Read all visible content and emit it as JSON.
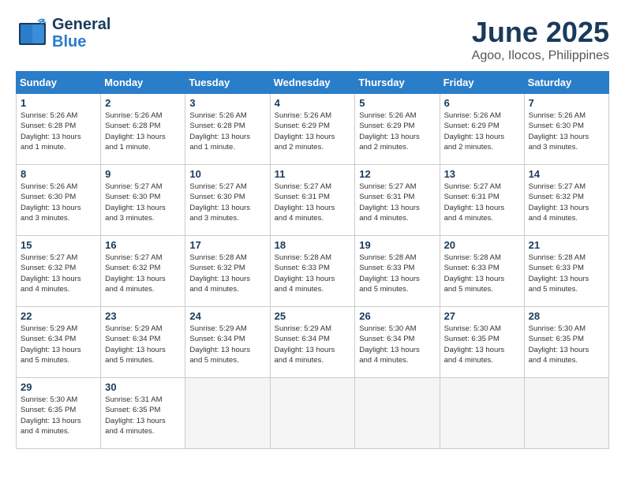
{
  "header": {
    "logo_line1": "General",
    "logo_line2": "Blue",
    "title": "June 2025",
    "subtitle": "Agoo, Ilocos, Philippines"
  },
  "weekdays": [
    "Sunday",
    "Monday",
    "Tuesday",
    "Wednesday",
    "Thursday",
    "Friday",
    "Saturday"
  ],
  "weeks": [
    [
      {
        "day": "1",
        "info": "Sunrise: 5:26 AM\nSunset: 6:28 PM\nDaylight: 13 hours\nand 1 minute."
      },
      {
        "day": "2",
        "info": "Sunrise: 5:26 AM\nSunset: 6:28 PM\nDaylight: 13 hours\nand 1 minute."
      },
      {
        "day": "3",
        "info": "Sunrise: 5:26 AM\nSunset: 6:28 PM\nDaylight: 13 hours\nand 1 minute."
      },
      {
        "day": "4",
        "info": "Sunrise: 5:26 AM\nSunset: 6:29 PM\nDaylight: 13 hours\nand 2 minutes."
      },
      {
        "day": "5",
        "info": "Sunrise: 5:26 AM\nSunset: 6:29 PM\nDaylight: 13 hours\nand 2 minutes."
      },
      {
        "day": "6",
        "info": "Sunrise: 5:26 AM\nSunset: 6:29 PM\nDaylight: 13 hours\nand 2 minutes."
      },
      {
        "day": "7",
        "info": "Sunrise: 5:26 AM\nSunset: 6:30 PM\nDaylight: 13 hours\nand 3 minutes."
      }
    ],
    [
      {
        "day": "8",
        "info": "Sunrise: 5:26 AM\nSunset: 6:30 PM\nDaylight: 13 hours\nand 3 minutes."
      },
      {
        "day": "9",
        "info": "Sunrise: 5:27 AM\nSunset: 6:30 PM\nDaylight: 13 hours\nand 3 minutes."
      },
      {
        "day": "10",
        "info": "Sunrise: 5:27 AM\nSunset: 6:30 PM\nDaylight: 13 hours\nand 3 minutes."
      },
      {
        "day": "11",
        "info": "Sunrise: 5:27 AM\nSunset: 6:31 PM\nDaylight: 13 hours\nand 4 minutes."
      },
      {
        "day": "12",
        "info": "Sunrise: 5:27 AM\nSunset: 6:31 PM\nDaylight: 13 hours\nand 4 minutes."
      },
      {
        "day": "13",
        "info": "Sunrise: 5:27 AM\nSunset: 6:31 PM\nDaylight: 13 hours\nand 4 minutes."
      },
      {
        "day": "14",
        "info": "Sunrise: 5:27 AM\nSunset: 6:32 PM\nDaylight: 13 hours\nand 4 minutes."
      }
    ],
    [
      {
        "day": "15",
        "info": "Sunrise: 5:27 AM\nSunset: 6:32 PM\nDaylight: 13 hours\nand 4 minutes."
      },
      {
        "day": "16",
        "info": "Sunrise: 5:27 AM\nSunset: 6:32 PM\nDaylight: 13 hours\nand 4 minutes."
      },
      {
        "day": "17",
        "info": "Sunrise: 5:28 AM\nSunset: 6:32 PM\nDaylight: 13 hours\nand 4 minutes."
      },
      {
        "day": "18",
        "info": "Sunrise: 5:28 AM\nSunset: 6:33 PM\nDaylight: 13 hours\nand 4 minutes."
      },
      {
        "day": "19",
        "info": "Sunrise: 5:28 AM\nSunset: 6:33 PM\nDaylight: 13 hours\nand 5 minutes."
      },
      {
        "day": "20",
        "info": "Sunrise: 5:28 AM\nSunset: 6:33 PM\nDaylight: 13 hours\nand 5 minutes."
      },
      {
        "day": "21",
        "info": "Sunrise: 5:28 AM\nSunset: 6:33 PM\nDaylight: 13 hours\nand 5 minutes."
      }
    ],
    [
      {
        "day": "22",
        "info": "Sunrise: 5:29 AM\nSunset: 6:34 PM\nDaylight: 13 hours\nand 5 minutes."
      },
      {
        "day": "23",
        "info": "Sunrise: 5:29 AM\nSunset: 6:34 PM\nDaylight: 13 hours\nand 5 minutes."
      },
      {
        "day": "24",
        "info": "Sunrise: 5:29 AM\nSunset: 6:34 PM\nDaylight: 13 hours\nand 5 minutes."
      },
      {
        "day": "25",
        "info": "Sunrise: 5:29 AM\nSunset: 6:34 PM\nDaylight: 13 hours\nand 4 minutes."
      },
      {
        "day": "26",
        "info": "Sunrise: 5:30 AM\nSunset: 6:34 PM\nDaylight: 13 hours\nand 4 minutes."
      },
      {
        "day": "27",
        "info": "Sunrise: 5:30 AM\nSunset: 6:35 PM\nDaylight: 13 hours\nand 4 minutes."
      },
      {
        "day": "28",
        "info": "Sunrise: 5:30 AM\nSunset: 6:35 PM\nDaylight: 13 hours\nand 4 minutes."
      }
    ],
    [
      {
        "day": "29",
        "info": "Sunrise: 5:30 AM\nSunset: 6:35 PM\nDaylight: 13 hours\nand 4 minutes."
      },
      {
        "day": "30",
        "info": "Sunrise: 5:31 AM\nSunset: 6:35 PM\nDaylight: 13 hours\nand 4 minutes."
      },
      {
        "day": "",
        "info": ""
      },
      {
        "day": "",
        "info": ""
      },
      {
        "day": "",
        "info": ""
      },
      {
        "day": "",
        "info": ""
      },
      {
        "day": "",
        "info": ""
      }
    ]
  ]
}
